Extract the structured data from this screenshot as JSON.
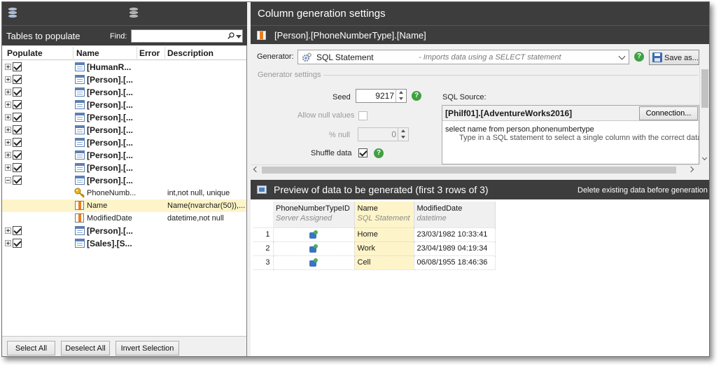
{
  "left_panel": {
    "header_title": "Tables to populate",
    "find_label": "Find:",
    "find_value": "",
    "columns": {
      "populate": "Populate",
      "name": "Name",
      "error": "Error",
      "description": "Description"
    },
    "rows": [
      {
        "type": "table",
        "name": "[HumanR...",
        "expanded": false,
        "checked": true
      },
      {
        "type": "table",
        "name": "[Person].[...",
        "expanded": false,
        "checked": true
      },
      {
        "type": "table",
        "name": "[Person].[...",
        "expanded": false,
        "checked": true
      },
      {
        "type": "table",
        "name": "[Person].[...",
        "expanded": false,
        "checked": true
      },
      {
        "type": "table",
        "name": "[Person].[...",
        "expanded": false,
        "checked": true
      },
      {
        "type": "table",
        "name": "[Person].[...",
        "expanded": false,
        "checked": true
      },
      {
        "type": "table",
        "name": "[Person].[...",
        "expanded": false,
        "checked": true
      },
      {
        "type": "table",
        "name": "[Person].[...",
        "expanded": false,
        "checked": true
      },
      {
        "type": "table",
        "name": "[Person].[...",
        "expanded": false,
        "checked": true
      },
      {
        "type": "table",
        "name": "[Person].[...",
        "expanded": true,
        "checked": true
      },
      {
        "type": "column",
        "icon": "key-icon",
        "name": "PhoneNumb...",
        "description": "int,not null, unique"
      },
      {
        "type": "column",
        "icon": "column-icon",
        "name": "Name",
        "description": "Name(nvarchar(50)),...",
        "selected": true
      },
      {
        "type": "column",
        "icon": "column-icon",
        "name": "ModifiedDate",
        "description": "datetime,not null"
      },
      {
        "type": "table",
        "name": "[Person].[...",
        "expanded": false,
        "checked": true
      },
      {
        "type": "table",
        "name": "[Sales].[S...",
        "expanded": false,
        "checked": true
      }
    ],
    "buttons": {
      "select_all": "Select All",
      "deselect_all": "Deselect All",
      "invert_selection": "Invert Selection"
    }
  },
  "right_panel": {
    "title": "Column generation settings",
    "column_path": "[Person].[PhoneNumberType].[Name]",
    "generator_label": "Generator:",
    "generator_name": "SQL Statement",
    "generator_desc": "- Imports data using a SELECT statement",
    "save_as": "Save as...",
    "generator_settings_label": "Generator settings",
    "seed_label": "Seed",
    "seed_value": "9217",
    "allow_null_label": "Allow null values",
    "pct_null_label": "% null",
    "pct_null_value": "0",
    "shuffle_label": "Shuffle data",
    "sql_source_label": "SQL Source:",
    "connection_name": "[Philf01].[AdventureWorks2016]",
    "connection_button": "Connection...",
    "sql_text": "select name from person.phonenumbertype",
    "sql_hint": "Type in a SQL statement to select a single column with the correct data",
    "preview_title": "Preview of data to be generated (first 3 rows of 3)",
    "delete_existing": "Delete existing data before generation",
    "preview": {
      "headers": [
        {
          "name": "PhoneNumberTypeID",
          "sub": "Server Assigned"
        },
        {
          "name": "Name",
          "sub": "SQL Statement"
        },
        {
          "name": "ModifiedDate",
          "sub": "datetime"
        }
      ],
      "rows": [
        {
          "n": "1",
          "name": "Home",
          "date": "23/03/1982 10:33:41"
        },
        {
          "n": "2",
          "name": "Work",
          "date": "23/04/1989 04:19:34"
        },
        {
          "n": "3",
          "name": "Cell",
          "date": "06/08/1955 18:46:36"
        }
      ]
    }
  },
  "icons": {
    "help": "?"
  }
}
